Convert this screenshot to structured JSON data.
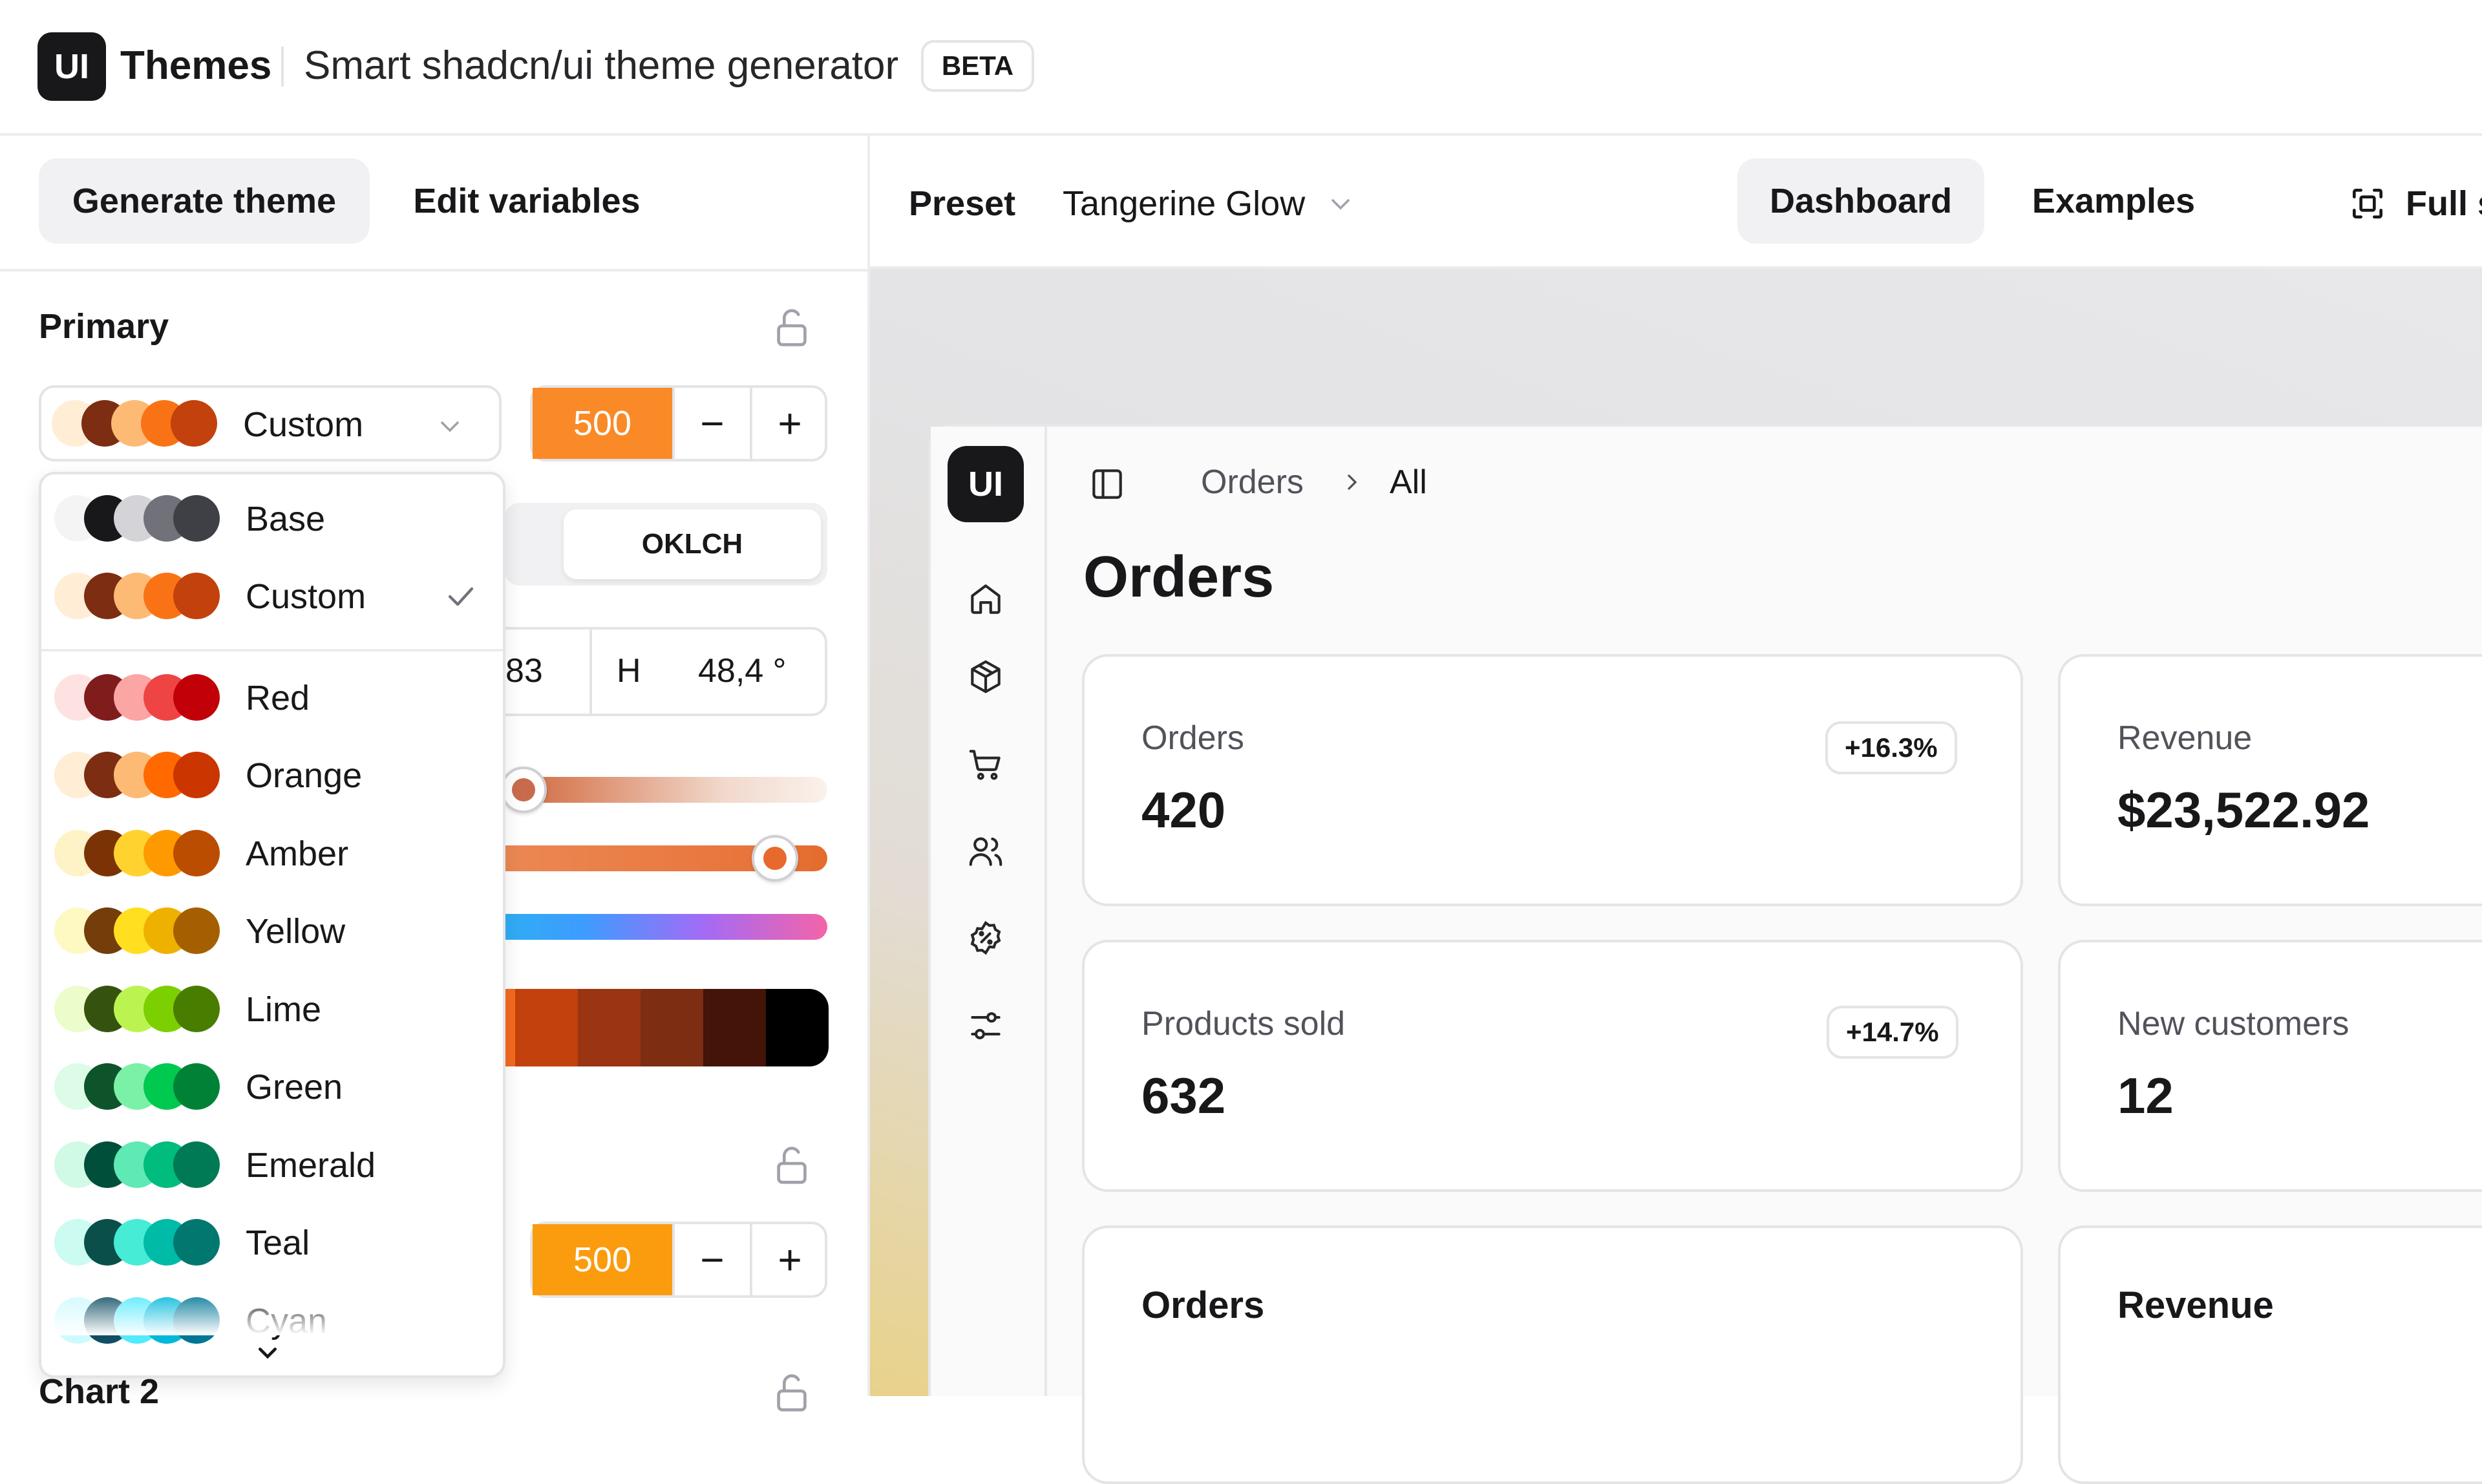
{
  "header": {
    "logo_text": "UI",
    "app_name": "Themes",
    "subtitle": "Smart shadcn/ui theme generator",
    "badge": "BETA"
  },
  "left_tabs": {
    "generate": "Generate theme",
    "edit": "Edit variables"
  },
  "primary": {
    "label": "Primary",
    "selected": "Custom",
    "shade": "500",
    "decrement": "−",
    "increment": "+",
    "mode": "OKLCH",
    "c_value": "83",
    "h_label": "H",
    "h_value": "48,4 °",
    "slider_lightness": 0.13,
    "slider_chroma": 0.85,
    "palette": [
      "#f36a20",
      "#c2410c",
      "#9a3412",
      "#7c2d12",
      "#431407",
      "#000000"
    ]
  },
  "secondary": {
    "shade": "500",
    "decrement": "−",
    "increment": "+"
  },
  "chart2_label": "Chart 2",
  "dropdown": {
    "items": [
      {
        "label": "Base",
        "colors": [
          "#f4f4f5",
          "#18181b",
          "#d4d4d8",
          "#71717a",
          "#3f3f46"
        ]
      },
      {
        "label": "Custom",
        "colors": [
          "#ffedd5",
          "#7c2d12",
          "#fdba74",
          "#f97316",
          "#c2410c"
        ],
        "selected": true
      },
      {
        "label": "Red",
        "colors": [
          "#fee2e2",
          "#7f1d1d",
          "#fca5a5",
          "#ef4444",
          "#c10007"
        ]
      },
      {
        "label": "Orange",
        "colors": [
          "#ffedd5",
          "#7c2d12",
          "#fdba74",
          "#ff6900",
          "#ca3500"
        ]
      },
      {
        "label": "Amber",
        "colors": [
          "#fef3c6",
          "#7b3306",
          "#ffd230",
          "#fe9a00",
          "#bb4d00"
        ]
      },
      {
        "label": "Yellow",
        "colors": [
          "#fef9c2",
          "#733e0a",
          "#ffdf20",
          "#efb100",
          "#a65f00"
        ]
      },
      {
        "label": "Lime",
        "colors": [
          "#ecfcca",
          "#35530e",
          "#bbf451",
          "#7ccf00",
          "#497d00"
        ]
      },
      {
        "label": "Green",
        "colors": [
          "#dcfce7",
          "#0d542b",
          "#7bf1a8",
          "#00c950",
          "#008236"
        ]
      },
      {
        "label": "Emerald",
        "colors": [
          "#d0fae5",
          "#004f3b",
          "#5ee9b5",
          "#00bc7d",
          "#007a55"
        ]
      },
      {
        "label": "Teal",
        "colors": [
          "#cbfbf1",
          "#0b4f4a",
          "#46ecd5",
          "#00bba7",
          "#00786f"
        ]
      },
      {
        "label": "Cyan",
        "colors": [
          "#cefafe",
          "#104e64",
          "#53eafd",
          "#00b8db",
          "#007595"
        ]
      }
    ]
  },
  "preset": {
    "label": "Preset",
    "value": "Tangerine Glow"
  },
  "view_tabs": {
    "dashboard": "Dashboard",
    "examples": "Examples",
    "fullscreen": "Full screen"
  },
  "preview": {
    "logo_text": "UI",
    "breadcrumb": [
      "Orders",
      "All"
    ],
    "title": "Orders",
    "cards": [
      {
        "label": "Orders",
        "value": "420",
        "badge": "+16.3%"
      },
      {
        "label": "Revenue",
        "value": "$23,522.92"
      },
      {
        "label": "Products sold",
        "value": "632",
        "badge": "+14.7%"
      },
      {
        "label": "New customers",
        "value": "12"
      }
    ],
    "chart_titles": [
      "Orders",
      "Revenue"
    ]
  }
}
